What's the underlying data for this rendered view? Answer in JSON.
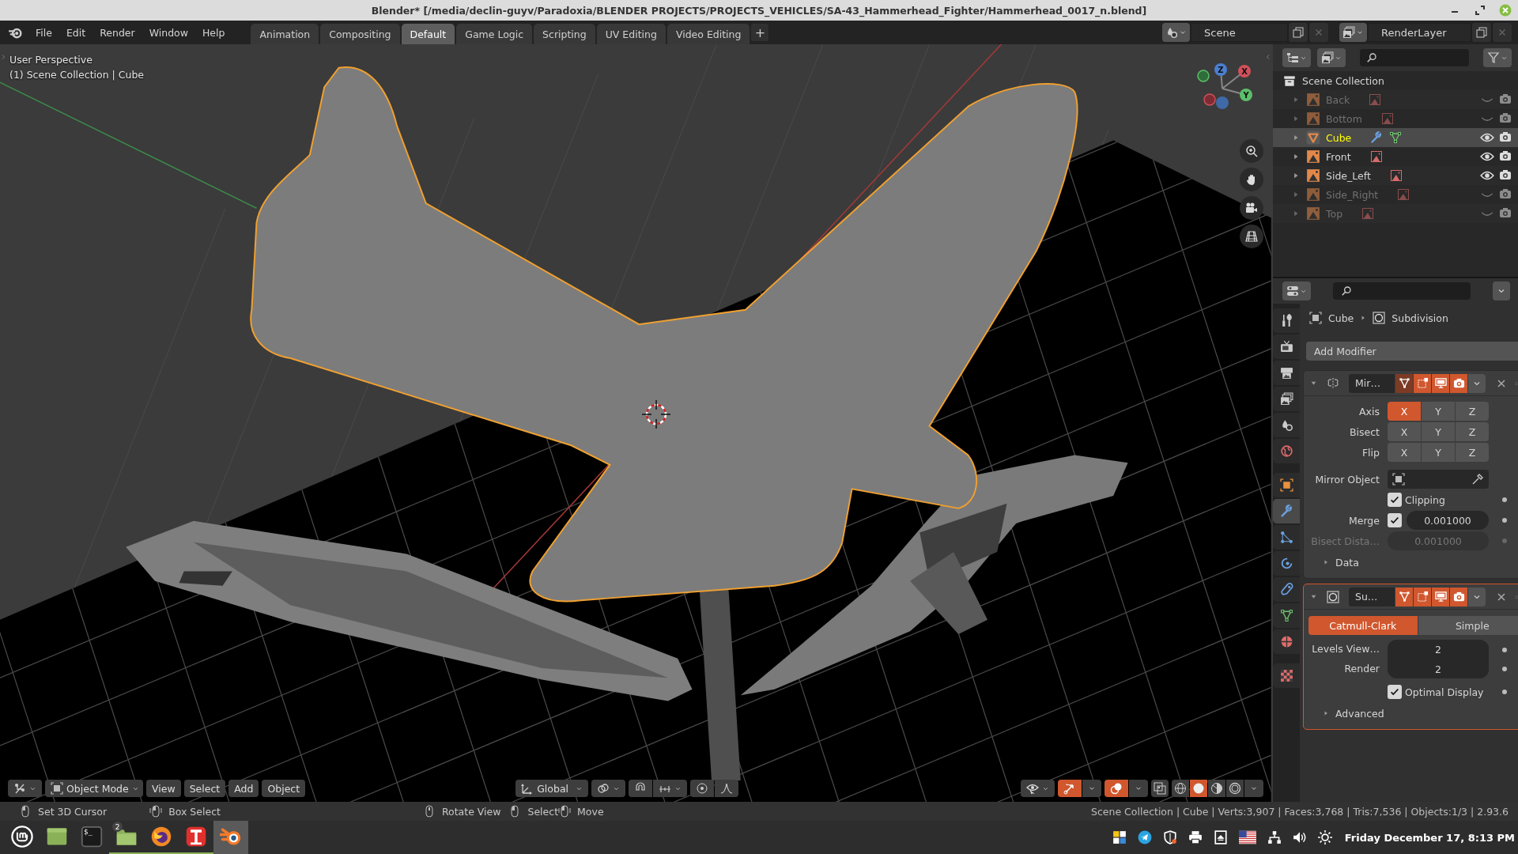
{
  "title_bar": {
    "title": "Blender* [/media/declin-guyv/Paradoxia/BLENDER PROJECTS/PROJECTS_VEHICLES/SA-43_Hammerhead_Fighter/Hammerhead_0017_n.blend]"
  },
  "menus": [
    "File",
    "Edit",
    "Render",
    "Window",
    "Help"
  ],
  "workspace_tabs": [
    {
      "label": "Animation",
      "selected": false
    },
    {
      "label": "Compositing",
      "selected": false
    },
    {
      "label": "Default",
      "selected": true
    },
    {
      "label": "Game Logic",
      "selected": false
    },
    {
      "label": "Scripting",
      "selected": false
    },
    {
      "label": "UV Editing",
      "selected": false
    },
    {
      "label": "Video Editing",
      "selected": false
    }
  ],
  "add_workspace": "+",
  "scene": {
    "name": "Scene"
  },
  "view_layer": {
    "name": "RenderLayer"
  },
  "viewport": {
    "view_name": "User Perspective",
    "context": "(1) Scene Collection | Cube",
    "gizmo_axes": [
      "X",
      "Y",
      "Z"
    ],
    "mode": "Object Mode",
    "menus": [
      "View",
      "Select",
      "Add",
      "Object"
    ],
    "orientation": "Global",
    "show_gizmo": true,
    "show_overlays": true,
    "shading": [
      {
        "kind": "wireframe",
        "selected": false
      },
      {
        "kind": "solid",
        "selected": true
      },
      {
        "kind": "material",
        "selected": false
      },
      {
        "kind": "rendered",
        "selected": false
      }
    ]
  },
  "outliner": {
    "root": "Scene Collection",
    "items": [
      {
        "name": "Back",
        "kind": "image",
        "visible": false,
        "selected": false
      },
      {
        "name": "Bottom",
        "kind": "image",
        "visible": false,
        "selected": false
      },
      {
        "name": "Cube",
        "kind": "mesh",
        "visible": true,
        "selected": true
      },
      {
        "name": "Front",
        "kind": "image",
        "visible": true,
        "selected": false
      },
      {
        "name": "Side_Left",
        "kind": "image",
        "visible": true,
        "selected": false
      },
      {
        "name": "Side_Right",
        "kind": "image",
        "visible": false,
        "selected": false
      },
      {
        "name": "Top",
        "kind": "image",
        "visible": false,
        "selected": false
      }
    ]
  },
  "properties": {
    "tabs": [
      {
        "kind": "tool",
        "selected": false
      },
      {
        "kind": "render",
        "selected": false
      },
      {
        "kind": "output",
        "selected": false
      },
      {
        "kind": "view_layer",
        "selected": false
      },
      {
        "kind": "scene",
        "selected": false
      },
      {
        "kind": "world",
        "selected": false
      },
      {
        "kind": "object",
        "selected": false
      },
      {
        "kind": "modifier",
        "selected": true
      },
      {
        "kind": "particles",
        "selected": false
      },
      {
        "kind": "physics",
        "selected": false
      },
      {
        "kind": "constraints",
        "selected": false
      },
      {
        "kind": "data",
        "selected": false
      },
      {
        "kind": "material",
        "selected": false
      },
      {
        "kind": "texture",
        "selected": false
      }
    ],
    "breadcrumb": [
      {
        "kind": "object",
        "label": "Cube"
      },
      {
        "kind": "modifier",
        "label": "Subdivision"
      }
    ],
    "add_modifier": "Add Modifier",
    "modifiers": [
      {
        "kind": "mirror",
        "name": "Mir…",
        "active": false,
        "expanded": true,
        "toggles": [
          {
            "kind": "on_cage",
            "on": false
          },
          {
            "kind": "edit_mode",
            "on": true
          },
          {
            "kind": "viewport",
            "on": true
          },
          {
            "kind": "render",
            "on": true
          }
        ],
        "axis_rows": [
          {
            "label": "Axis",
            "buttons": [
              {
                "label": "X",
                "selected": true
              },
              {
                "label": "Y",
                "selected": false
              },
              {
                "label": "Z",
                "selected": false
              }
            ]
          },
          {
            "label": "Bisect",
            "buttons": [
              {
                "label": "X",
                "selected": false
              },
              {
                "label": "Y",
                "selected": false
              },
              {
                "label": "Z",
                "selected": false
              }
            ]
          },
          {
            "label": "Flip",
            "buttons": [
              {
                "label": "X",
                "selected": false
              },
              {
                "label": "Y",
                "selected": false
              },
              {
                "label": "Z",
                "selected": false
              }
            ]
          }
        ],
        "mirror_object": {
          "label": "Mirror Object"
        },
        "clipping": {
          "label": "Clipping",
          "checked": true
        },
        "merge": {
          "label": "Merge",
          "checked": true,
          "value": "0.001000"
        },
        "bisect_distance": {
          "label": "Bisect Dista…",
          "value": "0.001000",
          "disabled": true
        },
        "subpanels": [
          {
            "label": "Data",
            "expanded": false
          }
        ]
      },
      {
        "kind": "subdivision",
        "name": "Su…",
        "active": true,
        "expanded": true,
        "toggles": [
          {
            "kind": "on_cage",
            "on": true
          },
          {
            "kind": "edit_mode",
            "on": true
          },
          {
            "kind": "viewport",
            "on": true
          },
          {
            "kind": "render",
            "on": true
          }
        ],
        "types": [
          {
            "label": "Catmull-Clark",
            "selected": true
          },
          {
            "label": "Simple",
            "selected": false
          }
        ],
        "levels_viewport": {
          "label": "Levels View…",
          "value": "2"
        },
        "render_levels": {
          "label": "Render",
          "value": "2"
        },
        "optimal_display": {
          "label": "Optimal Display",
          "checked": true
        },
        "subpanels": [
          {
            "label": "Advanced",
            "expanded": false
          }
        ]
      }
    ]
  },
  "status_bar": {
    "hints": [
      {
        "kind": "click",
        "label": "Set 3D Cursor"
      },
      {
        "kind": "drag",
        "label": "Box Select"
      },
      {
        "kind": "middle",
        "label": "Rotate View"
      },
      {
        "kind": "click",
        "label": "Select"
      },
      {
        "kind": "drag",
        "label": "Move"
      }
    ],
    "stats": "Scene Collection | Cube | Verts:3,907 | Faces:3,768 | Tris:7,536 | Objects:1/3 | 2.93.6"
  },
  "taskbar": {
    "apps": [
      {
        "kind": "menu",
        "active": false
      },
      {
        "kind": "files",
        "active": false
      },
      {
        "kind": "terminal",
        "label": "$_",
        "active": false
      },
      {
        "kind": "folder",
        "badge": "2",
        "active": false
      },
      {
        "kind": "browser",
        "active": false
      },
      {
        "kind": "installer",
        "active": false
      },
      {
        "kind": "blender",
        "active": true
      }
    ],
    "clock": "Friday December 17, 8:13 PM"
  }
}
